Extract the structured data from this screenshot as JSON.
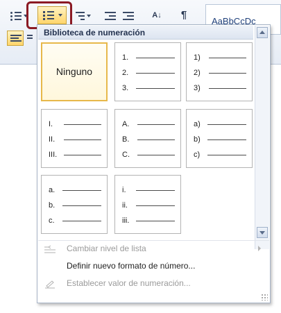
{
  "ribbon": {
    "styles_preview": "AaBbCcDc",
    "pilcrow": "¶",
    "sort_icon": "sort-az-icon"
  },
  "gallery": {
    "header": "Biblioteca de numeración",
    "none_label": "Ninguno",
    "tiles": [
      {
        "markers": [
          "1.",
          "2.",
          "3."
        ]
      },
      {
        "markers": [
          "1)",
          "2)",
          "3)"
        ]
      },
      {
        "markers": [
          "I.",
          "II.",
          "III."
        ]
      },
      {
        "markers": [
          "A.",
          "B.",
          "C."
        ]
      },
      {
        "markers": [
          "a)",
          "b)",
          "c)"
        ]
      },
      {
        "markers": [
          "a.",
          "b.",
          "c."
        ]
      },
      {
        "markers": [
          "i.",
          "ii.",
          "iii."
        ]
      }
    ]
  },
  "menu": {
    "change_level": "Cambiar nivel de lista",
    "define_format": "Definir nuevo formato de número...",
    "set_value": "Establecer valor de numeración..."
  },
  "colors": {
    "highlight": "#ffd56b",
    "selected_border": "#e7b84a",
    "annotation_ring": "#8b1a24"
  }
}
